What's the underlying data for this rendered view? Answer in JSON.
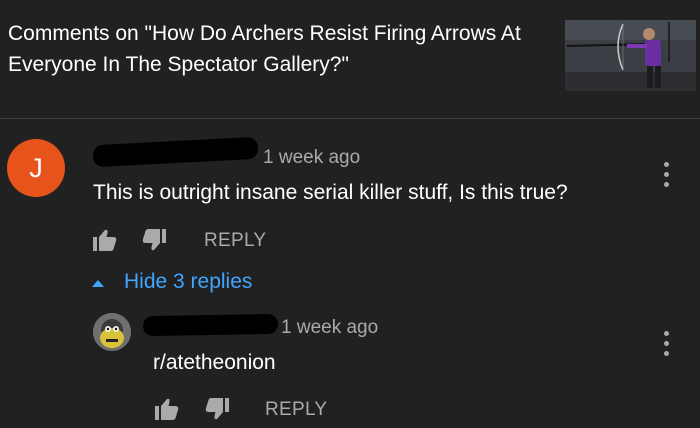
{
  "header": {
    "title": "Comments on \"How Do Archers Resist Firing Arrows At Everyone In The Spectator Gallery?\""
  },
  "icons": {
    "like": "thumbs-up-icon",
    "dislike": "thumbs-down-icon",
    "more": "vertical-dots-icon",
    "caret": "caret-up-icon"
  },
  "colors": {
    "background": "#212121",
    "avatar_main": "#e6541c",
    "link": "#3ea6ff",
    "muted": "#aaaaaa",
    "redaction": "#000000"
  },
  "comment": {
    "avatar_letter": "J",
    "timestamp": "1 week ago",
    "text": "This is outright insane serial killer stuff, Is this true?",
    "reply_label": "REPLY",
    "toggle_replies_label": "Hide 3 replies"
  },
  "reply": {
    "timestamp": "1 week ago",
    "text": "r/atetheonion",
    "reply_label": "REPLY"
  }
}
